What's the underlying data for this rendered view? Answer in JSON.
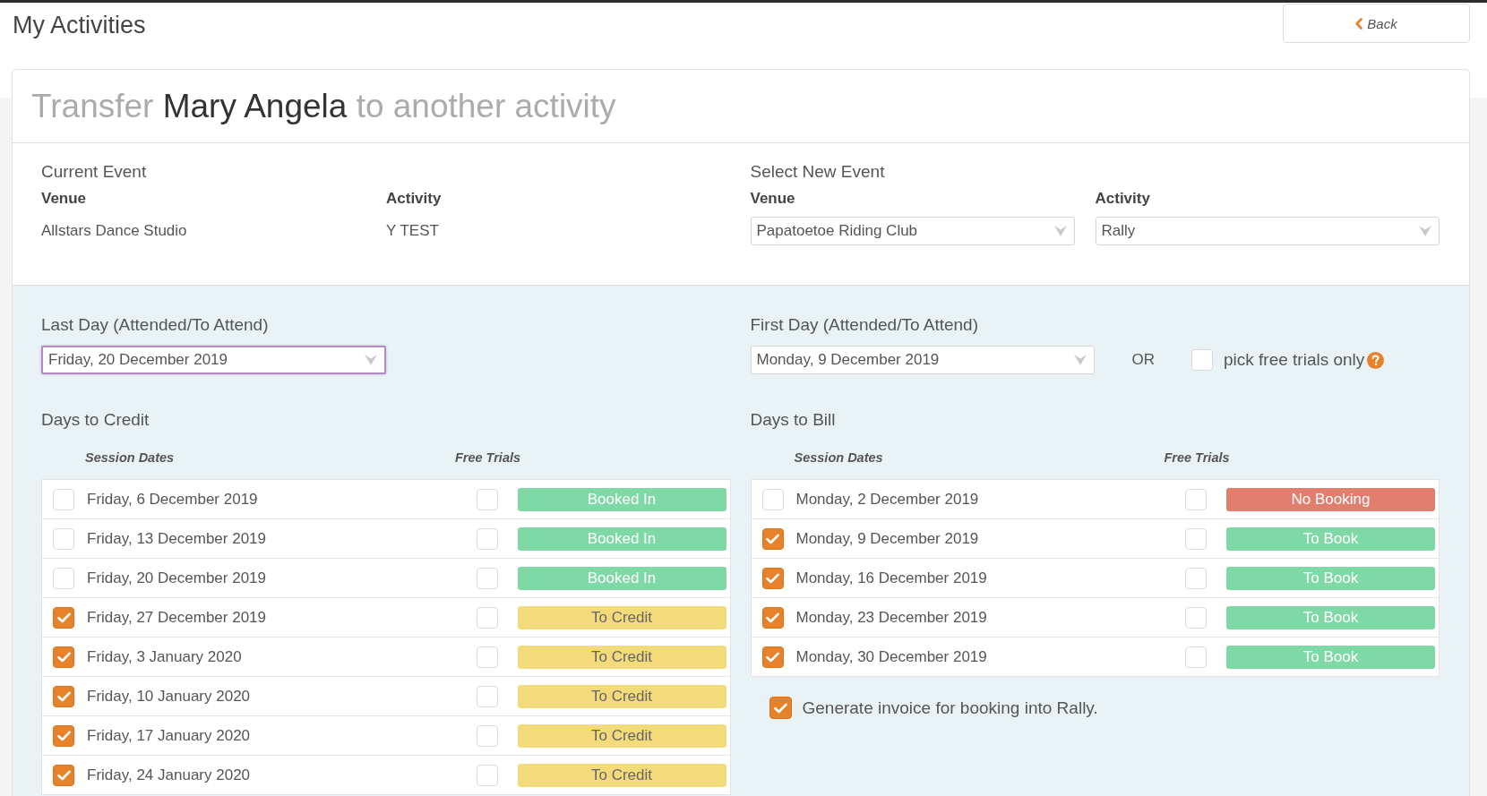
{
  "page": {
    "title": "My Activities",
    "back_button": "Back"
  },
  "heading": {
    "before": "Transfer",
    "name": "Mary Angela",
    "after": "to another activity"
  },
  "current_event": {
    "title": "Current Event",
    "venue_label": "Venue",
    "venue": "Allstars Dance Studio",
    "activity_label": "Activity",
    "activity": "Y TEST"
  },
  "new_event": {
    "title": "Select New Event",
    "venue_label": "Venue",
    "venue": "Papatoetoe Riding Club",
    "activity_label": "Activity",
    "activity": "Rally"
  },
  "last_day": {
    "label": "Last Day (Attended/To Attend)",
    "value": "Friday, 20 December 2019",
    "focused": true
  },
  "first_day": {
    "label": "First Day (Attended/To Attend)",
    "value": "Monday, 9 December 2019",
    "focused": false,
    "or": "OR",
    "free_trials_only": {
      "label": "pick free trials only",
      "checked": false
    }
  },
  "days_to_credit": {
    "title": "Days to Credit",
    "columns": [
      "Session Dates",
      "Free Trials"
    ],
    "rows": [
      {
        "checked": false,
        "date": "Friday, 6 December 2019",
        "free_trial": false,
        "status": "Booked In",
        "color": "#7ed9a7"
      },
      {
        "checked": false,
        "date": "Friday, 13 December 2019",
        "free_trial": false,
        "status": "Booked In",
        "color": "#7ed9a7"
      },
      {
        "checked": false,
        "date": "Friday, 20 December 2019",
        "free_trial": false,
        "status": "Booked In",
        "color": "#7ed9a7"
      },
      {
        "checked": true,
        "date": "Friday, 27 December 2019",
        "free_trial": false,
        "status": "To Credit",
        "color": "#f3da7a"
      },
      {
        "checked": true,
        "date": "Friday, 3 January 2020",
        "free_trial": false,
        "status": "To Credit",
        "color": "#f3da7a"
      },
      {
        "checked": true,
        "date": "Friday, 10 January 2020",
        "free_trial": false,
        "status": "To Credit",
        "color": "#f3da7a"
      },
      {
        "checked": true,
        "date": "Friday, 17 January 2020",
        "free_trial": false,
        "status": "To Credit",
        "color": "#f3da7a"
      },
      {
        "checked": true,
        "date": "Friday, 24 January 2020",
        "free_trial": false,
        "status": "To Credit",
        "color": "#f3da7a"
      }
    ]
  },
  "days_to_bill": {
    "title": "Days to Bill",
    "columns": [
      "Session Dates",
      "Free Trials"
    ],
    "rows": [
      {
        "checked": false,
        "date": "Monday, 2 December 2019",
        "free_trial": false,
        "status": "No Booking",
        "color": "#e27e6e"
      },
      {
        "checked": true,
        "date": "Monday, 9 December 2019",
        "free_trial": false,
        "status": "To Book",
        "color": "#7ed9a7"
      },
      {
        "checked": true,
        "date": "Monday, 16 December 2019",
        "free_trial": false,
        "status": "To Book",
        "color": "#7ed9a7"
      },
      {
        "checked": true,
        "date": "Monday, 23 December 2019",
        "free_trial": false,
        "status": "To Book",
        "color": "#7ed9a7"
      },
      {
        "checked": true,
        "date": "Monday, 30 December 2019",
        "free_trial": false,
        "status": "To Book",
        "color": "#7ed9a7"
      }
    ]
  },
  "invoice": {
    "checked": true,
    "label": "Generate invoice for booking into Rally."
  }
}
